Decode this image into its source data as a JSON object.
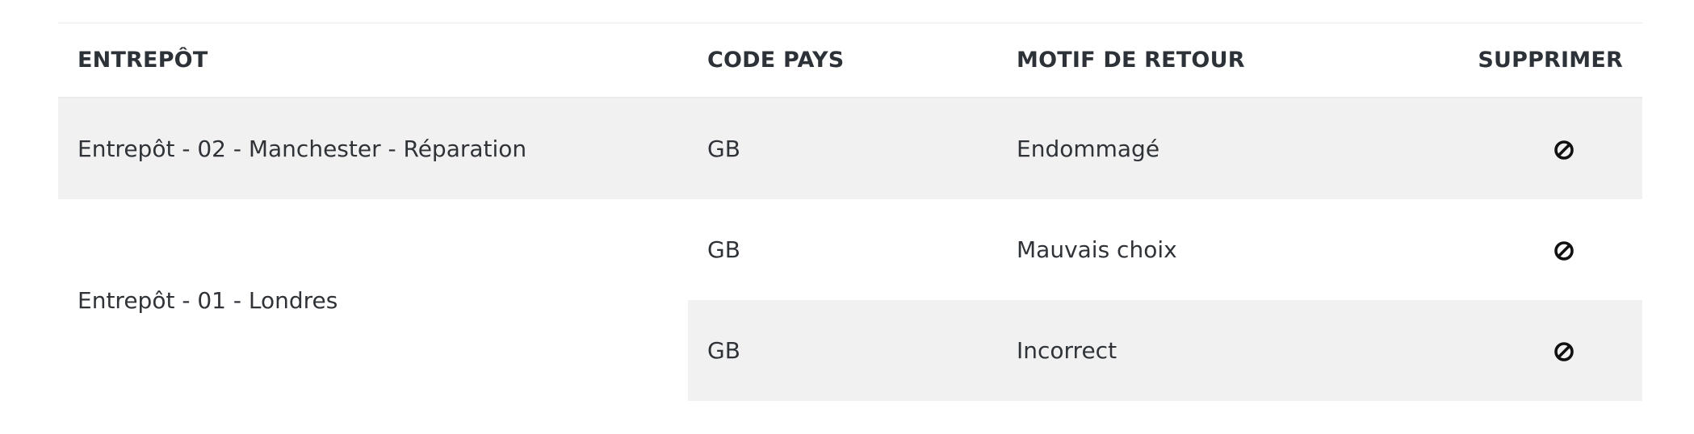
{
  "table": {
    "headers": {
      "warehouse": "ENTREPÔT",
      "country_code": "CODE PAYS",
      "return_reason": "MOTIF DE RETOUR",
      "delete": "SUPPRIMER"
    },
    "groups": [
      {
        "warehouse": "Entrepôt - 02 - Manchester - Réparation",
        "rows": [
          {
            "country_code": "GB",
            "return_reason": "Endommagé",
            "delete_icon": "delete-prohibited-icon"
          }
        ]
      },
      {
        "warehouse": "Entrepôt - 01 - Londres",
        "rows": [
          {
            "country_code": "GB",
            "return_reason": "Mauvais choix",
            "delete_icon": "delete-prohibited-icon"
          },
          {
            "country_code": "GB",
            "return_reason": "Incorrect",
            "delete_icon": "delete-prohibited-icon"
          }
        ]
      }
    ]
  },
  "colors": {
    "stripe": "#f1f1f1",
    "text": "#2f3338",
    "icon": "#111111"
  }
}
